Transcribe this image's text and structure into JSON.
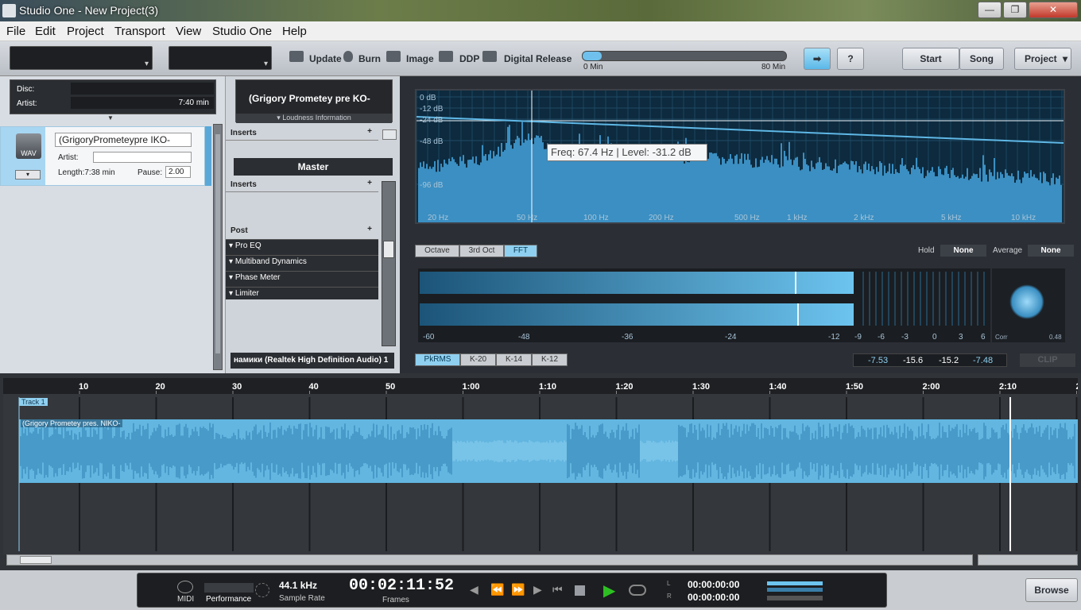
{
  "window": {
    "title": "Studio One - New Project(3)",
    "min": "—",
    "max": "❐",
    "close": "✕"
  },
  "menu": [
    "File",
    "Edit",
    "Project",
    "Transport",
    "View",
    "Studio One",
    "Help"
  ],
  "toolbar": {
    "update": "Update",
    "burn": "Burn",
    "image": "Image",
    "ddp": "DDP",
    "digital_release": "Digital Release",
    "progress_start": "0 Min",
    "progress_end": "80 Min",
    "help": "?",
    "start": "Start",
    "song": "Song",
    "project": "Project"
  },
  "disc": {
    "disc_label": "Disc:",
    "artist_label": "Artist:",
    "time": "7:40 min"
  },
  "track_item": {
    "badge": "WAV",
    "name": "(GrigoryPrometeypre   IKO-",
    "artist_label": "Artist:",
    "length": "Length:7:38 min",
    "pause_label": "Pause:",
    "pause_value": "2.00"
  },
  "mid": {
    "track_title": "(Grigory Prometey pre   KO-",
    "loudness": "Loudness Information",
    "inserts1": "Inserts",
    "master": "Master",
    "inserts2": "Inserts",
    "post": "Post",
    "plugins": [
      "Pro EQ",
      "Multiband Dynamics",
      "Phase Meter",
      "Limiter"
    ],
    "output": "намики (Realtek High Definition Audio) 1"
  },
  "spectrum": {
    "db_labels": [
      "0 dB",
      "-12 dB",
      "-24 dB",
      "-48 dB",
      "-96 dB"
    ],
    "freq_labels": [
      "20 Hz",
      "50 Hz",
      "100 Hz",
      "200 Hz",
      "500 Hz",
      "1 kHz",
      "2 kHz",
      "5 kHz",
      "10 kHz"
    ],
    "tooltip": "Freq: 67.4 Hz | Level: -31.2 dB",
    "modes": [
      "Octave",
      "3rd Oct",
      "FFT"
    ],
    "active_mode": "FFT",
    "hold_label": "Hold",
    "hold_value": "None",
    "avg_label": "Average",
    "avg_value": "None"
  },
  "meter": {
    "scale": [
      "-60",
      "-48",
      "-36",
      "-24",
      "-12",
      "-9",
      "-6",
      "-3",
      "0",
      "3",
      "6"
    ],
    "corr_label": "Corr",
    "corr_value": "0.48",
    "modes": [
      "PkRMS",
      "K-20",
      "K-14",
      "K-12"
    ],
    "active_mode": "PkRMS",
    "readouts": [
      "-7.53",
      "-15.6",
      "-15.2",
      "-7.48"
    ],
    "clip": "CLIP"
  },
  "timeline": {
    "marks": [
      "10",
      "20",
      "30",
      "40",
      "50",
      "1:00",
      "1:10",
      "1:20",
      "1:30",
      "1:40",
      "1:50",
      "2:00",
      "2:10",
      "2:"
    ],
    "track_label": "Track 1",
    "clip_name": "(Grigory Prometey pres. NIKO-"
  },
  "transport": {
    "midi": "MIDI",
    "performance": "Performance",
    "rate": "44.1 kHz",
    "rate_label": "Sample Rate",
    "time": "00:02:11:52",
    "time_label": "Frames",
    "l_time": "00:00:00:00",
    "r_time": "00:00:00:00",
    "l": "L",
    "r": "R",
    "browse": "Browse"
  },
  "colors": {
    "accent": "#8fd0f0",
    "wave": "#62b6e0",
    "play": "#2ec022"
  }
}
